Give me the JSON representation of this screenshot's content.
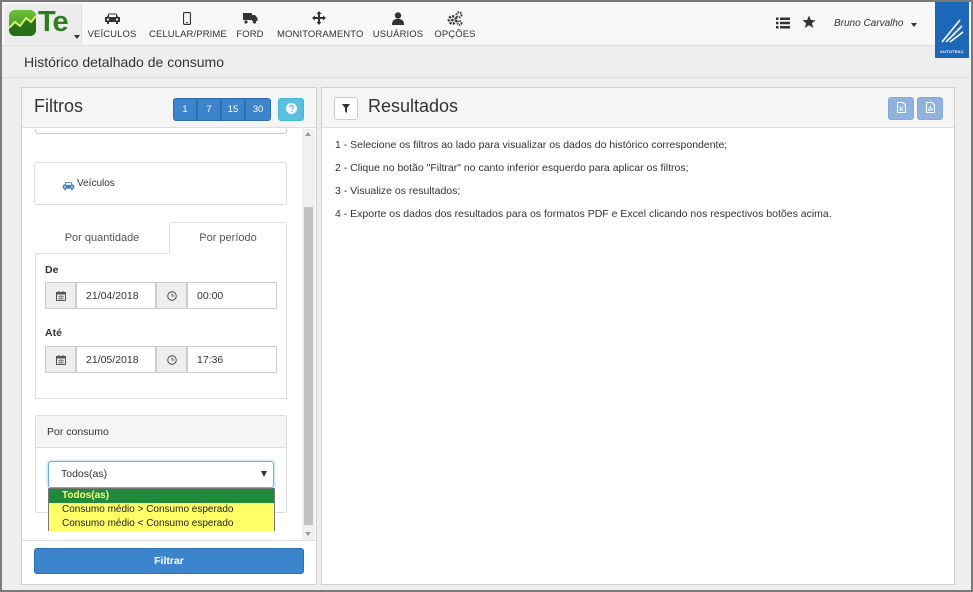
{
  "app": {
    "logo_text": "Te",
    "page_title": "Histórico detalhado de consumo"
  },
  "nav": {
    "items": [
      {
        "label": "VEÍCULOS",
        "icon": "car-icon"
      },
      {
        "label": "CELULAR/PRIME",
        "icon": "mobile-icon"
      },
      {
        "label": "FORD",
        "icon": "truck-icon"
      },
      {
        "label": "MONITORAMENTO",
        "icon": "move-icon"
      },
      {
        "label": "USUÁRIOS",
        "icon": "user-icon"
      },
      {
        "label": "OPÇÕES",
        "icon": "cogs-icon"
      }
    ],
    "user_name": "Bruno Carvalho",
    "brand": "AUTOTRAC"
  },
  "filters": {
    "title": "Filtros",
    "ranges": [
      "1",
      "7",
      "15",
      "30"
    ],
    "help_icon": "question-icon",
    "vehicles_label": "Veículos",
    "tabs": [
      {
        "label": "Por quantidade",
        "active": false
      },
      {
        "label": "Por período",
        "active": true
      }
    ],
    "from": {
      "label": "De",
      "date": "21/04/2018",
      "time": "00:00"
    },
    "to": {
      "label": "Até",
      "date": "21/05/2018",
      "time": "17:36"
    },
    "consumo": {
      "title": "Por consumo",
      "selected": "Todos(as)",
      "options": [
        "Todos(as)",
        "Consumo médio > Consumo esperado",
        "Consumo médio < Consumo esperado"
      ]
    },
    "filter_button": "Filtrar"
  },
  "results": {
    "title": "Resultados",
    "steps": [
      "1 - Selecione os filtros ao lado para visualizar os dados do histórico correspondente;",
      "2 - Clique no botão \"Filtrar\" no canto inferior esquerdo para aplicar os filtros;",
      "3 - Visualize os resultados;",
      "4 - Exporte os dados dos resultados para os formatos PDF e Excel clicando nos respectivos botões acima."
    ]
  },
  "colors": {
    "primary": "#3c84cc",
    "info": "#5bc0de",
    "brand_green": "#2e7d1c",
    "autotrac_blue": "#1c67b8",
    "option_selected": "#1f8a3a",
    "option_highlight": "#ffff66"
  }
}
